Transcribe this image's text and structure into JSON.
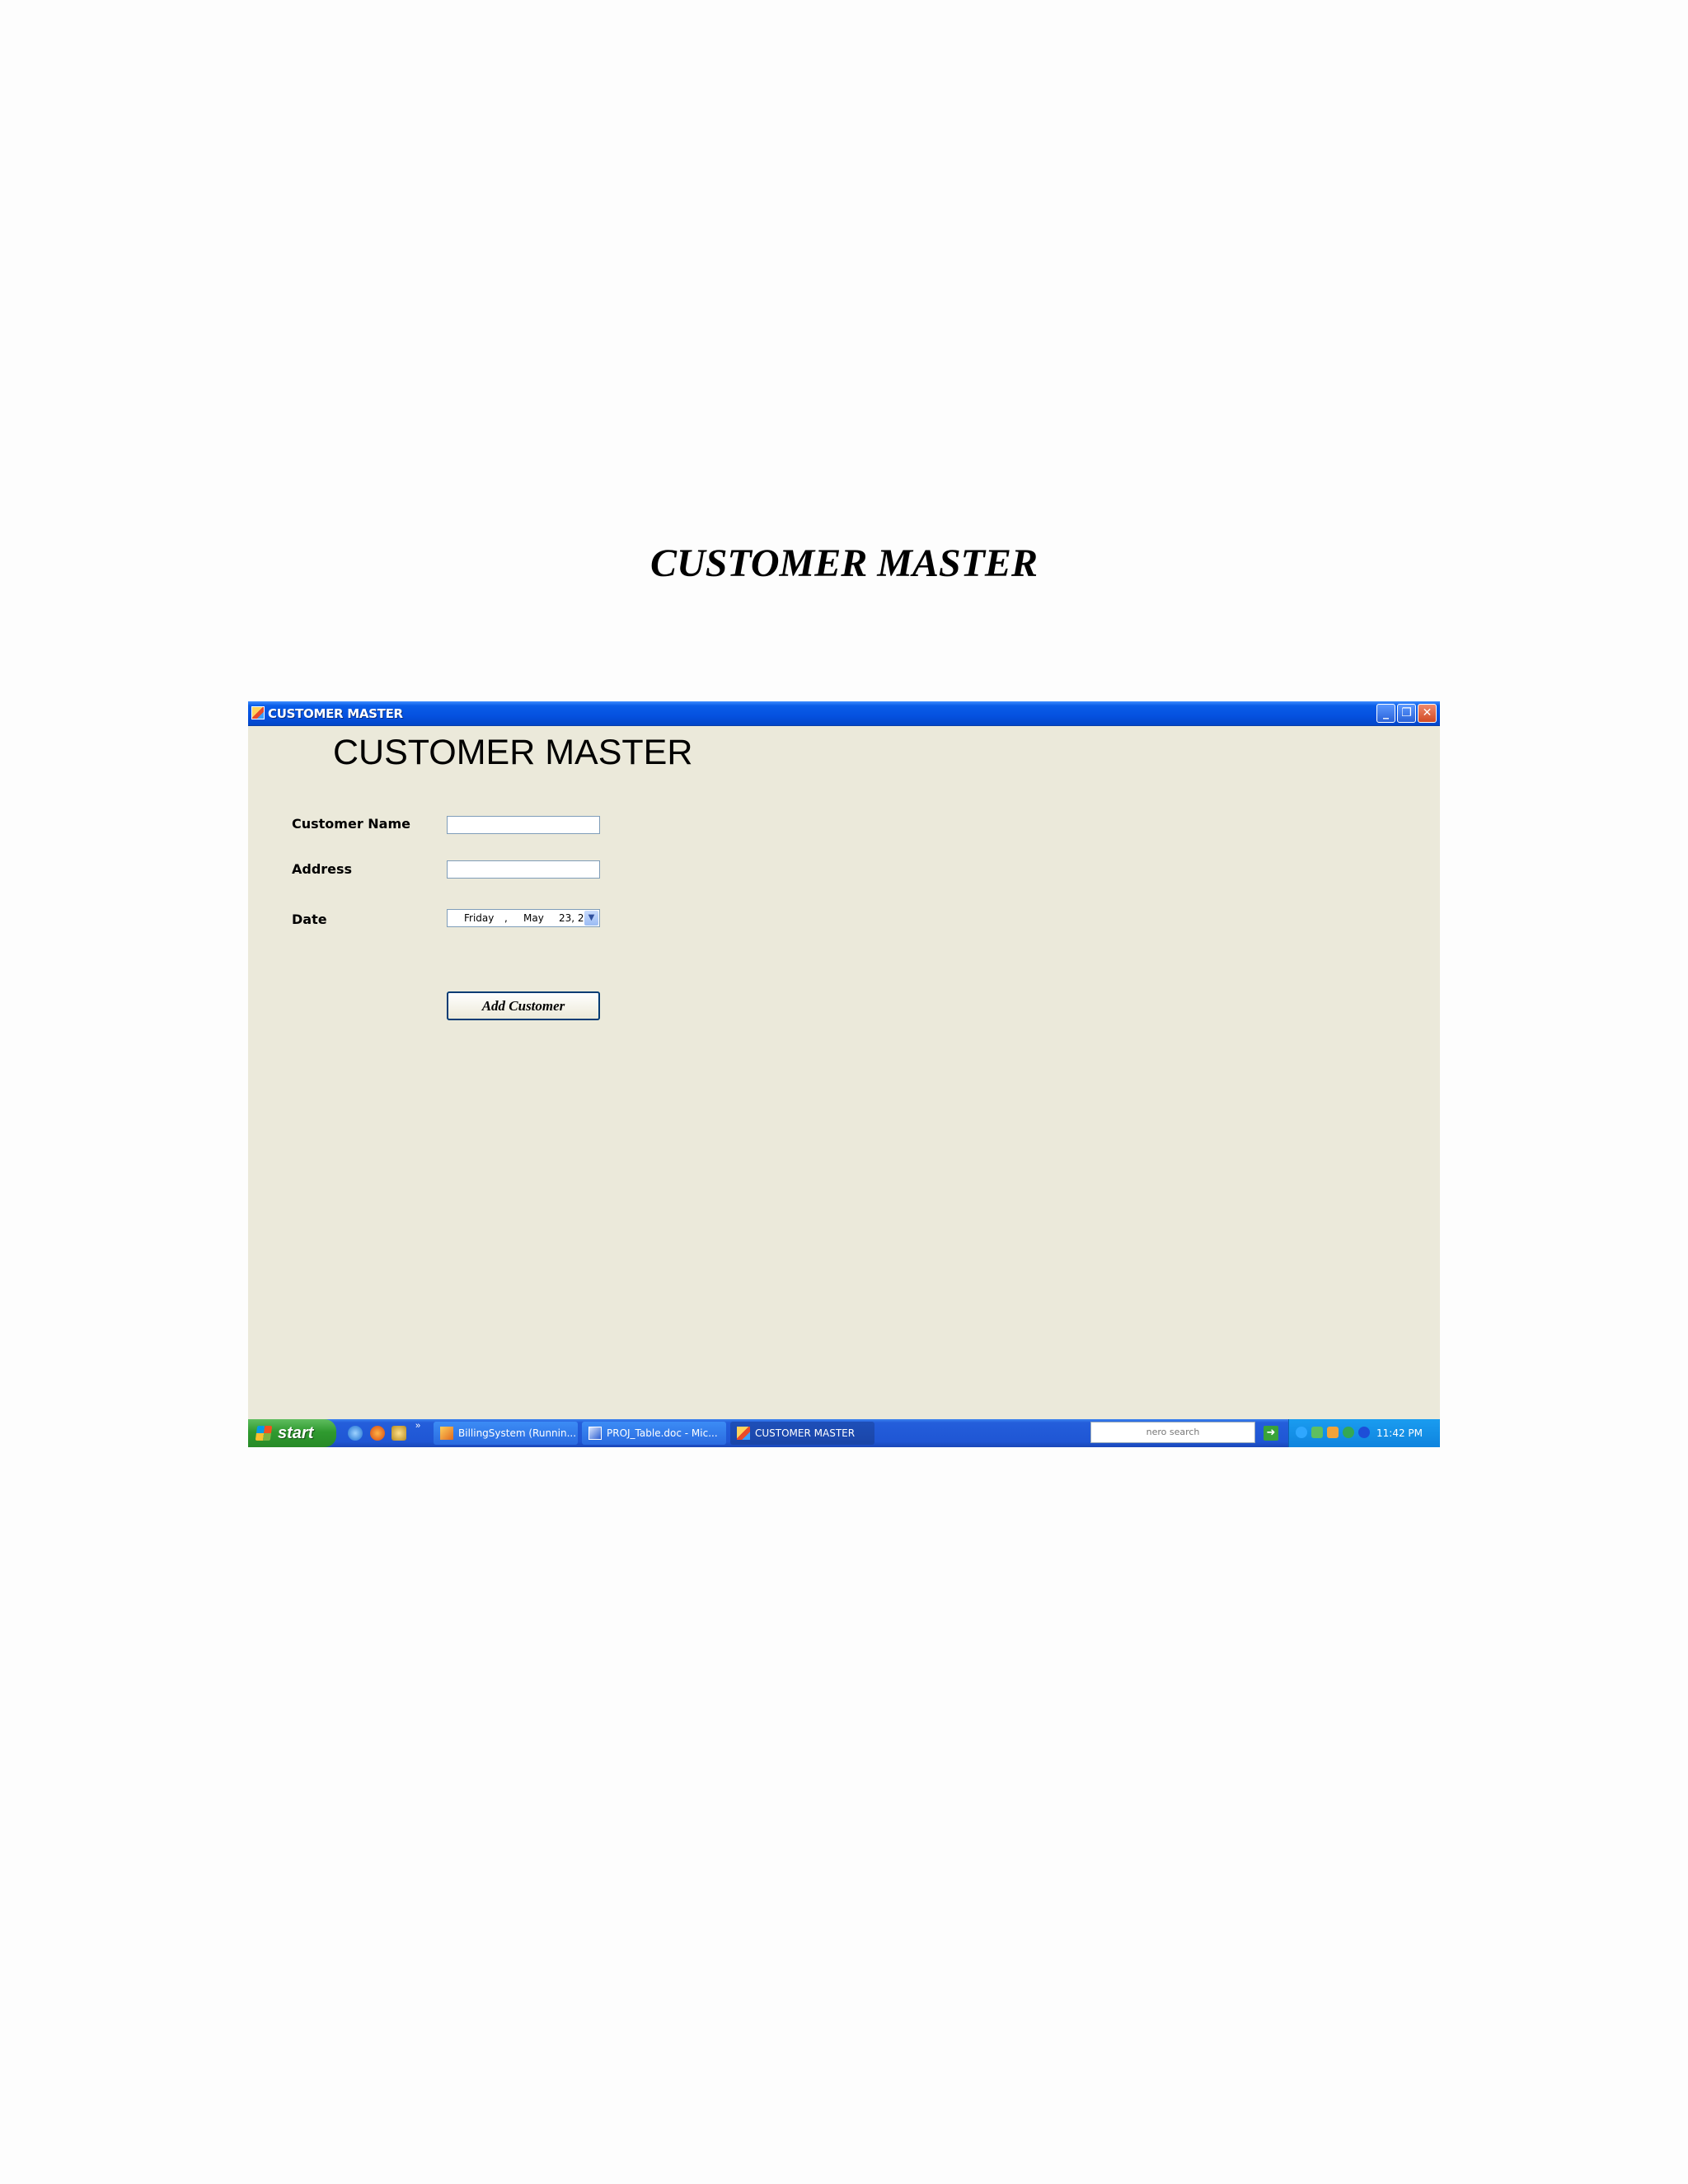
{
  "document": {
    "heading": "CUSTOMER MASTER"
  },
  "window": {
    "title": "CUSTOMER MASTER",
    "buttons": {
      "minimize": "_",
      "maximize": "❐",
      "close": "✕"
    }
  },
  "form": {
    "title": "CUSTOMER MASTER",
    "customer_name_label": "Customer Name",
    "customer_name_value": "",
    "address_label": "Address",
    "address_value": "",
    "date_label": "Date",
    "date": {
      "day_name": "Friday",
      "separator": ",",
      "month": "May",
      "day_year": "23, 2"
    },
    "add_button_label": "Add Customer"
  },
  "taskbar": {
    "start_label": "start",
    "quick_launch_more": "»",
    "tasks": [
      {
        "label": "BillingSystem (Runnin..."
      },
      {
        "label": "PROJ_Table.doc - Mic..."
      },
      {
        "label": "CUSTOMER MASTER"
      }
    ],
    "search_label": "nero search",
    "go_arrow": "➜",
    "clock": "11:42 PM"
  },
  "icons": [
    "app-icon",
    "minimize-icon",
    "maximize-icon",
    "close-icon",
    "dropdown-arrow-icon",
    "windows-flag-icon",
    "ie-icon",
    "firefox-icon",
    "quicklaunch-icon",
    "task-app-icon",
    "word-doc-icon",
    "network-icon",
    "bluetooth-icon"
  ]
}
